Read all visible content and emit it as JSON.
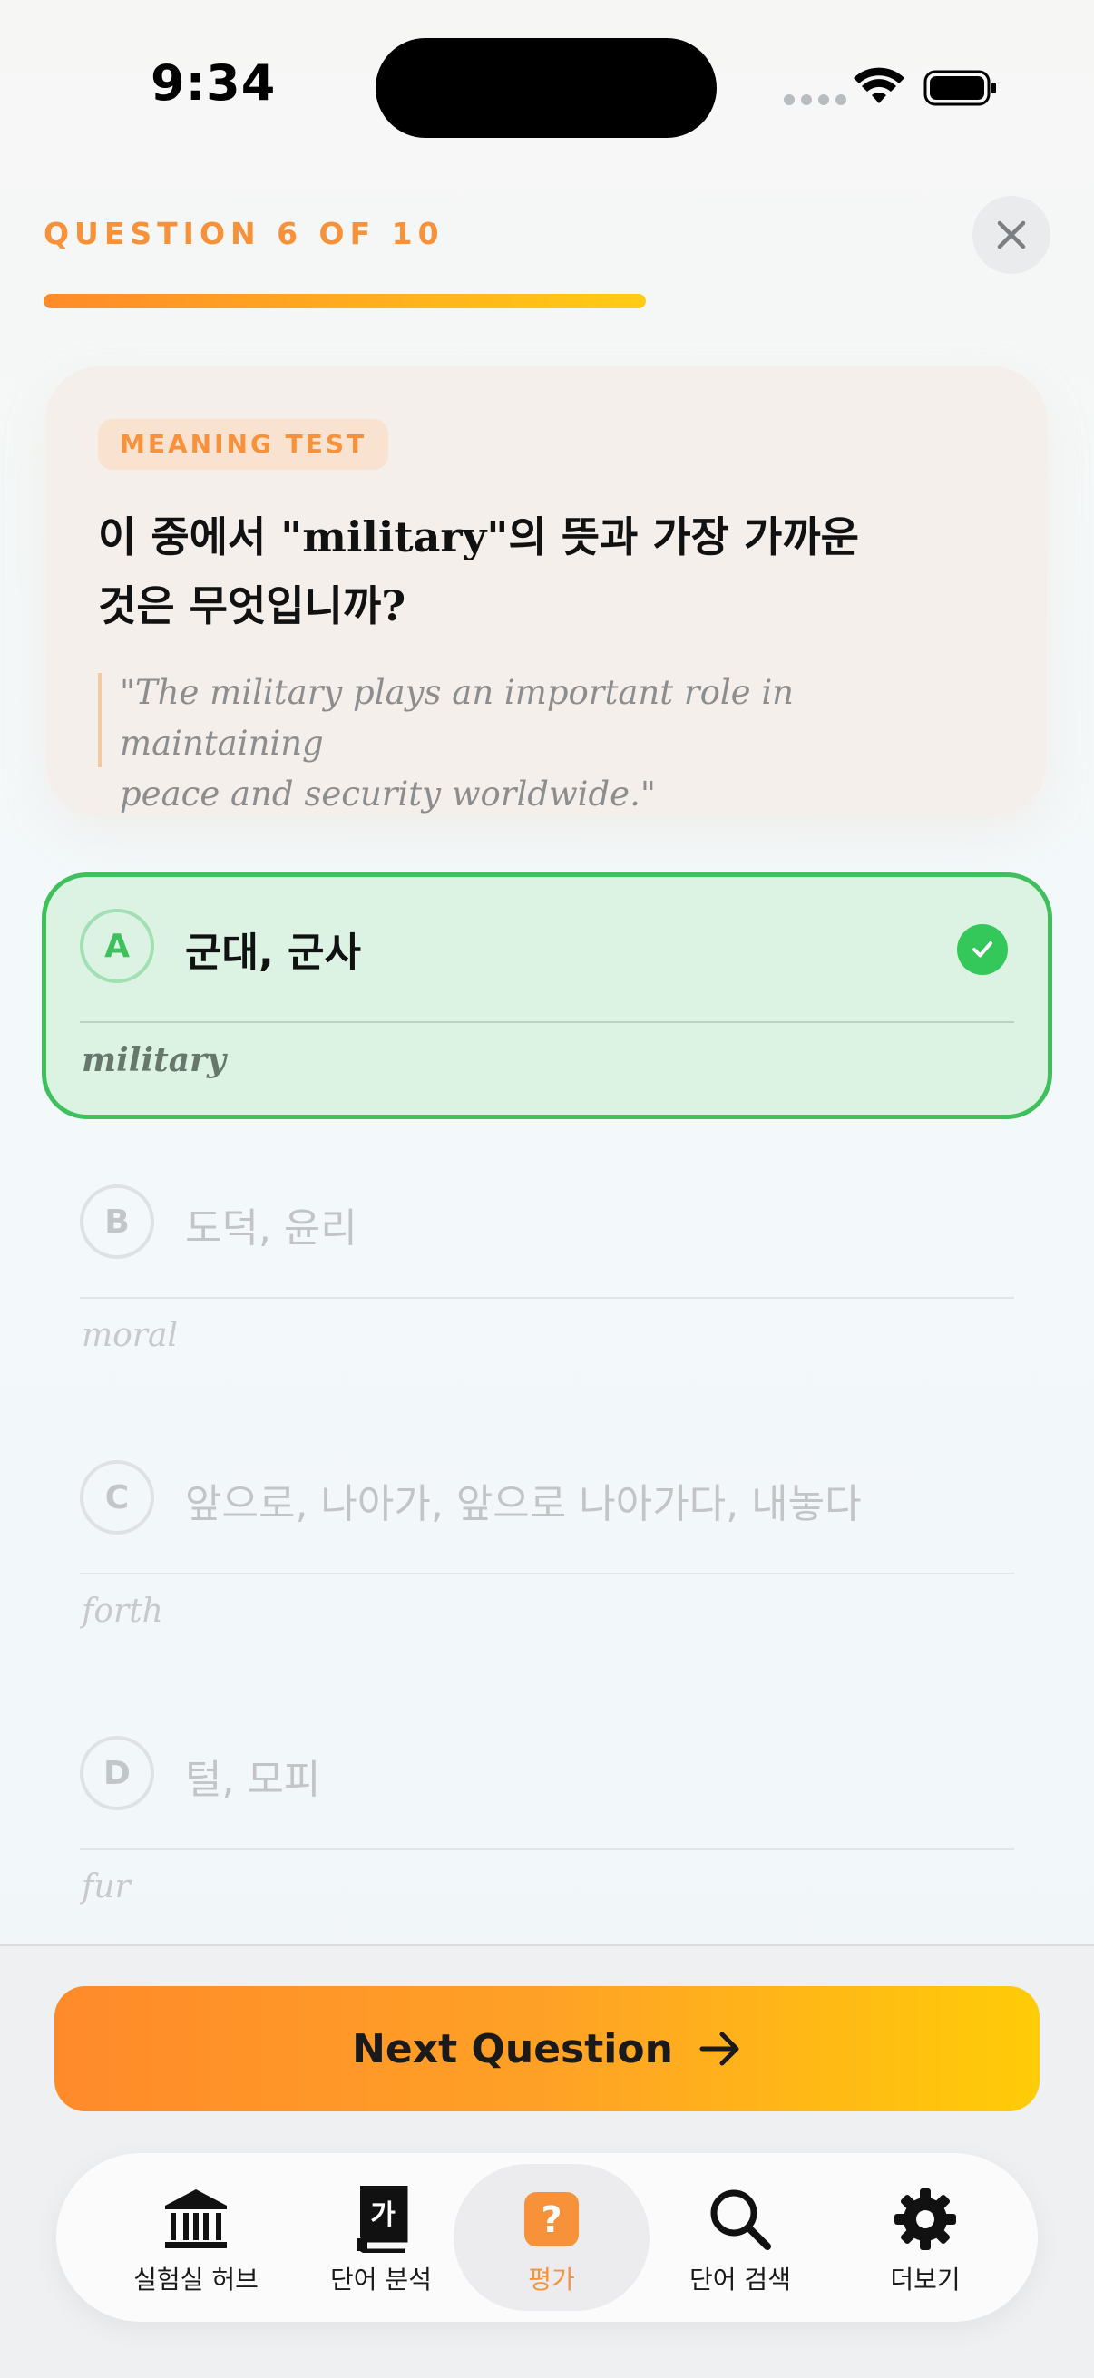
{
  "status_bar": {
    "time": "9:34"
  },
  "header": {
    "counter": "QUESTION 6 OF 10",
    "progress": 0.6
  },
  "question": {
    "badge": "MEANING TEST",
    "prompt_line1": "이 중에서 \"military\"의 뜻과 가장 가까운",
    "prompt_line2": "것은 무엇입니까?",
    "example_line1": "\"The military plays an important role in maintaining",
    "example_line2": "peace and security worldwide.\""
  },
  "options": [
    {
      "letter": "A",
      "meaning": "군대, 군사",
      "word": "military",
      "state": "correct"
    },
    {
      "letter": "B",
      "meaning": "도덕, 윤리",
      "word": "moral",
      "state": "faded"
    },
    {
      "letter": "C",
      "meaning": "앞으로, 나아가, 앞으로 나아가다, 내놓다",
      "word": "forth",
      "state": "faded"
    },
    {
      "letter": "D",
      "meaning": "털, 모피",
      "word": "fur",
      "state": "faded"
    }
  ],
  "next_button": {
    "label": "Next Question"
  },
  "tabs": [
    {
      "label": "실험실 허브",
      "icon": "bank-icon"
    },
    {
      "label": "단어 분석",
      "icon": "dictionary-icon",
      "glyph": "가"
    },
    {
      "label": "평가",
      "icon": "question-icon",
      "glyph": "?",
      "active": true
    },
    {
      "label": "단어 검색",
      "icon": "search-icon"
    },
    {
      "label": "더보기",
      "icon": "gear-icon"
    }
  ],
  "colors": {
    "accent": "#f7913a",
    "correct": "#34c759",
    "gradient_start": "#ff8a2a",
    "gradient_end": "#ffcc08"
  }
}
